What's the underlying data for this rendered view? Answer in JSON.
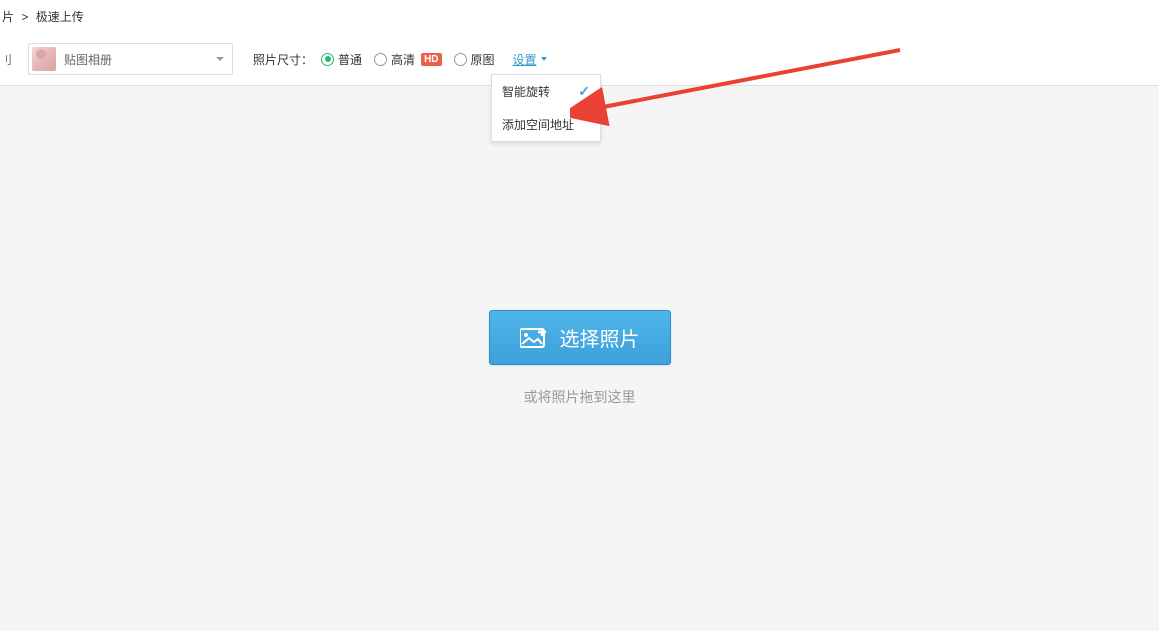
{
  "breadcrumb": {
    "first": "片",
    "separator": ">",
    "last": "极速上传"
  },
  "toolbar": {
    "left_text": "刂",
    "album_name": "贴图相册",
    "size_label": "照片尺寸：",
    "radios": {
      "normal": "普通",
      "hd": "高清",
      "hd_badge": "HD",
      "original": "原图"
    },
    "settings_label": "设置"
  },
  "dropdown": {
    "item1": "智能旋转",
    "item2": "添加空间地址"
  },
  "upload": {
    "button_label": "选择照片",
    "drag_text": "或将照片拖到这里"
  }
}
